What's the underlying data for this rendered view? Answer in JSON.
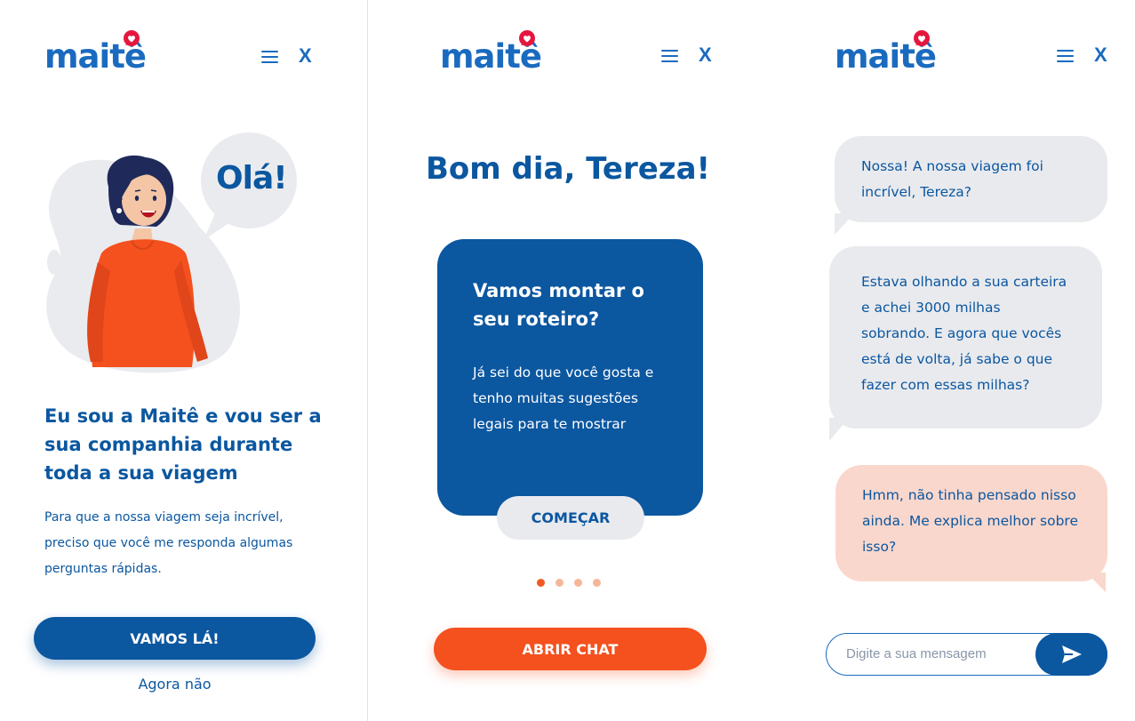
{
  "brand": {
    "name": "maitê",
    "blue": "#0b57a0",
    "orange": "#f4511e",
    "heart_color": "#e5173f"
  },
  "nav": {
    "menu_icon": "hamburger-icon",
    "close_label": "X"
  },
  "screen1": {
    "bubble_text": "Olá!",
    "heading": "Eu sou a Maitê e vou ser a sua companhia durante toda a sua viagem",
    "body": "Para que a nossa viagem seja incrível, preciso que você me responda algumas perguntas rápidas.",
    "primary_button": "VAMOS LÁ!",
    "secondary_link": "Agora não"
  },
  "screen2": {
    "greeting": "Bom dia, Tereza!",
    "card_title": "Vamos montar o seu roteiro?",
    "card_body": "Já sei do que você gosta e tenho muitas sugestões legais para te mostrar",
    "card_button": "COMEÇAR",
    "pagination": {
      "total": 4,
      "active": 1
    },
    "primary_button": "ABRIR CHAT"
  },
  "screen3": {
    "messages": [
      {
        "from": "maite",
        "text": "Nossa! A nossa viagem foi incrível, Tereza?"
      },
      {
        "from": "maite",
        "text": "Estava olhando a sua carteira e achei 3000 milhas sobrando. E agora que vocês está de volta, já sabe o que fazer com essas milhas?"
      },
      {
        "from": "user",
        "text": "Hmm, não tinha pensado nisso ainda. Me explica melhor sobre isso?"
      }
    ],
    "input_placeholder": "Digite a sua mensagem",
    "send_icon": "send-icon"
  }
}
